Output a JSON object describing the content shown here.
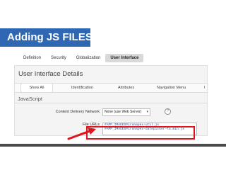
{
  "slide": {
    "title": "Adding JS FILES"
  },
  "tabs": [
    {
      "label": "Definition"
    },
    {
      "label": "Security"
    },
    {
      "label": "Globalization"
    },
    {
      "label": "User Interface",
      "active": true
    }
  ],
  "panel": {
    "title": "User Interface Details",
    "subtabs": [
      {
        "label": "Show All"
      },
      {
        "label": "Identification"
      },
      {
        "label": "Attributes"
      },
      {
        "label": "Navigation Menu"
      },
      {
        "label": "I"
      }
    ],
    "section": "JavaScript",
    "cdn": {
      "label": "Content Delivery Network",
      "value": "None (use Web Server)",
      "arrow": "▾",
      "help": "?"
    },
    "file_urls": {
      "label": "File URLs",
      "lines": [
        "#APP_IMAGES#iranapex-util.js",
        "#APP_IMAGES#iranapex-datepicker-fa.min.js"
      ]
    }
  },
  "colors": {
    "title_bar": "#2f67b3",
    "highlight": "#e0141e",
    "bottom_bar": "#4a4a4a"
  }
}
